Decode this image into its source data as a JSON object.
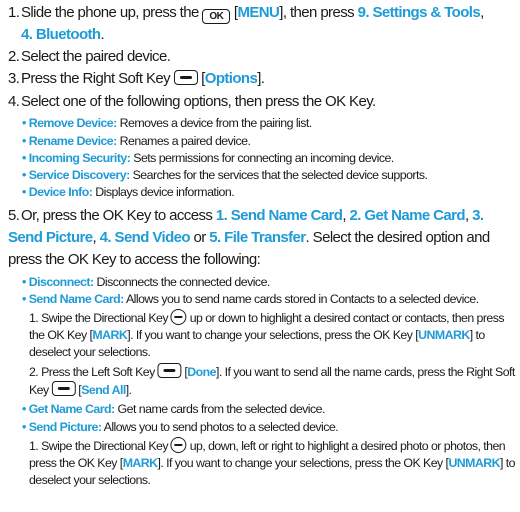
{
  "steps": {
    "s1": {
      "n": "1.",
      "a": "Slide the phone up, press the",
      "key": "OK",
      "b": "[",
      "menu": "MENU",
      "c": "], then press",
      "settings": "9. Settings & Tools",
      "d": ",",
      "bt": "4. Bluetooth",
      "e": "."
    },
    "s2": {
      "n": "2.",
      "a": "Select the paired device."
    },
    "s3": {
      "n": "3.",
      "a": "Press the Right Soft Key",
      "b": "[",
      "options": "Options",
      "c": "]."
    },
    "s4": {
      "n": "4.",
      "a": "Select one of the following options, then press the OK Key."
    },
    "s5": {
      "n": "5.",
      "a": "Or, press the OK Key to access",
      "o1": "1. Send Name Card",
      "c1": ",",
      "o2": "2. Get Name Card",
      "c2": ",",
      "o3": "3. Send Picture",
      "c3": ",",
      "o4": "4. Send Video",
      "c4": "or",
      "o5": "5. File Transfer",
      "b": ". Select the desired option and press the OK Key to access the following:"
    }
  },
  "options4": [
    {
      "label": "Remove Device:",
      "desc": "Removes a device from the pairing list."
    },
    {
      "label": "Rename Device:",
      "desc": "Renames a paired device."
    },
    {
      "label": "Incoming Security:",
      "desc": "Sets permissions for connecting an incoming device."
    },
    {
      "label": "Service Discovery:",
      "desc": "Searches for the services that the selected device supports."
    },
    {
      "label": "Device Info:",
      "desc": "Displays device information."
    }
  ],
  "options5": {
    "disconnect": {
      "label": "Disconnect:",
      "desc": "Disconnects the connected device."
    },
    "send_name_card": {
      "label": "Send Name Card:",
      "desc": "Allows you to send name cards stored in Contacts to a selected device."
    },
    "snc1": {
      "n": "1.",
      "a": "Swipe the Directional Key",
      "b": "up or down to highlight a desired contact or contacts, then press the OK Key [",
      "mark": "MARK",
      "c": "]. If you want to change your selections, press the OK Key [",
      "unmark": "UNMARK",
      "d": "] to deselect your selections."
    },
    "snc2": {
      "n": "2.",
      "a": "Press the Left Soft Key",
      "b": "[",
      "done": "Done",
      "c": "]. If you want to send all the name cards, press the Right Soft Key",
      "d": "[",
      "sendall": "Send All",
      "e": "]."
    },
    "get_name_card": {
      "label": "Get Name Card:",
      "desc": "Get name cards from the selected device."
    },
    "send_picture": {
      "label": "Send Picture:",
      "desc": "Allows you to send photos to a selected device."
    },
    "sp1": {
      "n": "1.",
      "a": "Swipe the Directional Key",
      "b": "up, down, left or right to highlight a desired photo or photos, then press the OK Key [",
      "mark": "MARK",
      "c": "]. If you want to change your selections, press the OK Key [",
      "unmark": "UNMARK",
      "d": "] to deselect your selections."
    }
  }
}
